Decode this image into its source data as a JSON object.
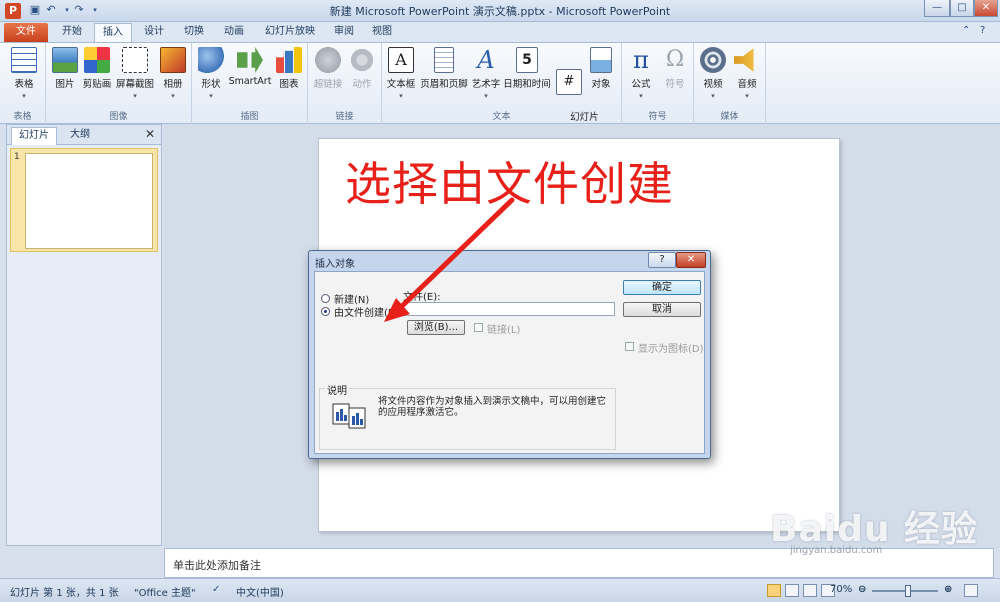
{
  "window": {
    "title": "新建 Microsoft PowerPoint 演示文稿.pptx - Microsoft PowerPoint",
    "app_icon": "P",
    "minimize": "—",
    "maximize": "□",
    "close": "✕"
  },
  "tabs": [
    "文件",
    "开始",
    "插入",
    "设计",
    "切换",
    "动画",
    "幻灯片放映",
    "审阅",
    "视图"
  ],
  "ribbon": {
    "groups": [
      {
        "label": "表格",
        "buttons": [
          "表格"
        ]
      },
      {
        "label": "图像",
        "buttons": [
          "图片",
          "剪贴画",
          "屏幕截图",
          "相册"
        ]
      },
      {
        "label": "插图",
        "buttons": [
          "形状",
          "SmartArt",
          "图表"
        ]
      },
      {
        "label": "链接",
        "buttons": [
          "超链接",
          "动作"
        ]
      },
      {
        "label": "文本",
        "buttons": [
          "文本框",
          "页眉和页脚",
          "艺术字",
          "日期和时间",
          "幻灯片\n编号",
          "对象"
        ]
      },
      {
        "label": "符号",
        "buttons": [
          "公式",
          "符号"
        ]
      },
      {
        "label": "媒体",
        "buttons": [
          "视频",
          "音频"
        ]
      }
    ]
  },
  "left_pane": {
    "tab_slides": "幻灯片",
    "tab_outline": "大纲",
    "close": "✕",
    "slide_number": "1"
  },
  "annotation": "选择由文件创建",
  "notes_placeholder": "单击此处添加备注",
  "status": {
    "slide_info": "幻灯片 第 1 张，共 1 张",
    "theme": "\"Office 主题\"",
    "language": "中文(中国)",
    "zoom": "70%",
    "zoom_fraction": 0.55
  },
  "dialog": {
    "title": "插入对象",
    "help": "?",
    "close": "✕",
    "radio_new": "新建(N)",
    "radio_from_file": "由文件创建(F)",
    "file_label": "文件(E):",
    "file_value": "",
    "browse": "浏览(B)...",
    "link": "链接(L)",
    "ok": "确定",
    "cancel": "取消",
    "display_as_icon": "显示为图标(D)",
    "result_title": "说明",
    "result_text": "将文件内容作为对象插入到演示文稿中，可以用创建它的应用程序激活它。"
  },
  "watermark": {
    "logo": "Baidu 经验",
    "url": "jingyan.baidu.com"
  }
}
